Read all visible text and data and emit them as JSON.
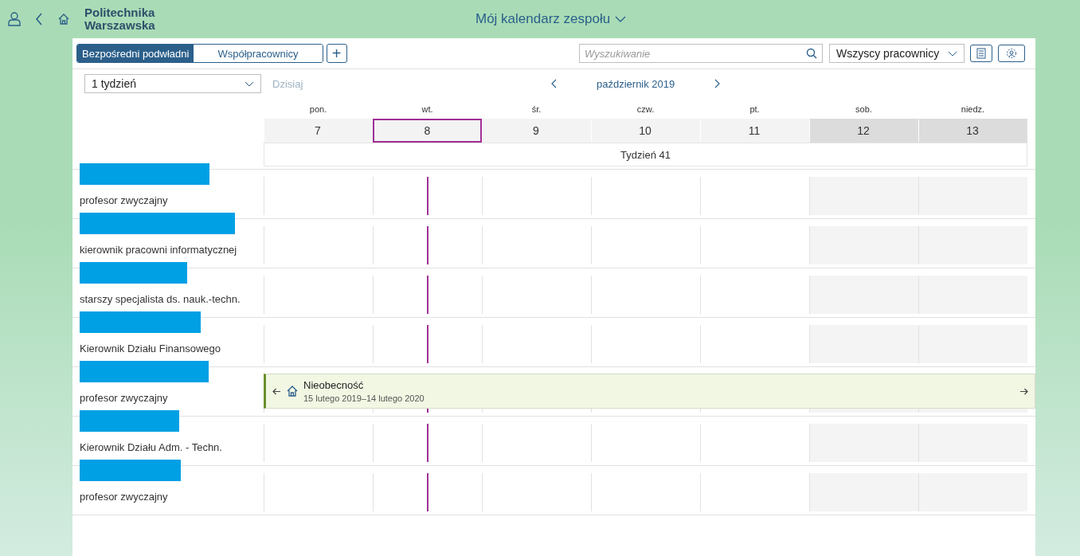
{
  "header": {
    "logo_lines": [
      "Politechnika",
      "Warszawska"
    ],
    "title": "Mój kalendarz zespołu"
  },
  "tabs": [
    {
      "label": "Bezpośredni podwładni",
      "selected": true
    },
    {
      "label": "Współpracownicy",
      "selected": false
    }
  ],
  "add_button": "+",
  "search": {
    "placeholder": "Wyszukiwanie"
  },
  "filter": {
    "value": "Wszyscy pracownicy"
  },
  "period": {
    "value": "1 tydzień"
  },
  "today_button": "Dzisiaj",
  "month": "październik 2019",
  "days": [
    {
      "name": "pon.",
      "date": "7",
      "weekend": false,
      "selected": false
    },
    {
      "name": "wt.",
      "date": "8",
      "weekend": false,
      "selected": true
    },
    {
      "name": "śr.",
      "date": "9",
      "weekend": false,
      "selected": false
    },
    {
      "name": "czw.",
      "date": "10",
      "weekend": false,
      "selected": false
    },
    {
      "name": "pt.",
      "date": "11",
      "weekend": false,
      "selected": false
    },
    {
      "name": "sob.",
      "date": "12",
      "weekend": true,
      "selected": false
    },
    {
      "name": "niedz.",
      "date": "13",
      "weekend": true,
      "selected": false
    }
  ],
  "week_label": "Tydzień 41",
  "employees": [
    {
      "title": "profesor zwyczajny"
    },
    {
      "title": "kierownik pracowni informatycznej"
    },
    {
      "title": "starszy specjalista ds. nauk.-techn."
    },
    {
      "title": "Kierownik Działu Finansowego"
    },
    {
      "title": "profesor zwyczajny",
      "absence": {
        "label": "Nieobecność",
        "dates": "15 lutego 2019–14 lutego 2020"
      }
    },
    {
      "title": "Kierownik Działu Adm. - Techn."
    },
    {
      "title": "profesor zwyczajny"
    }
  ]
}
